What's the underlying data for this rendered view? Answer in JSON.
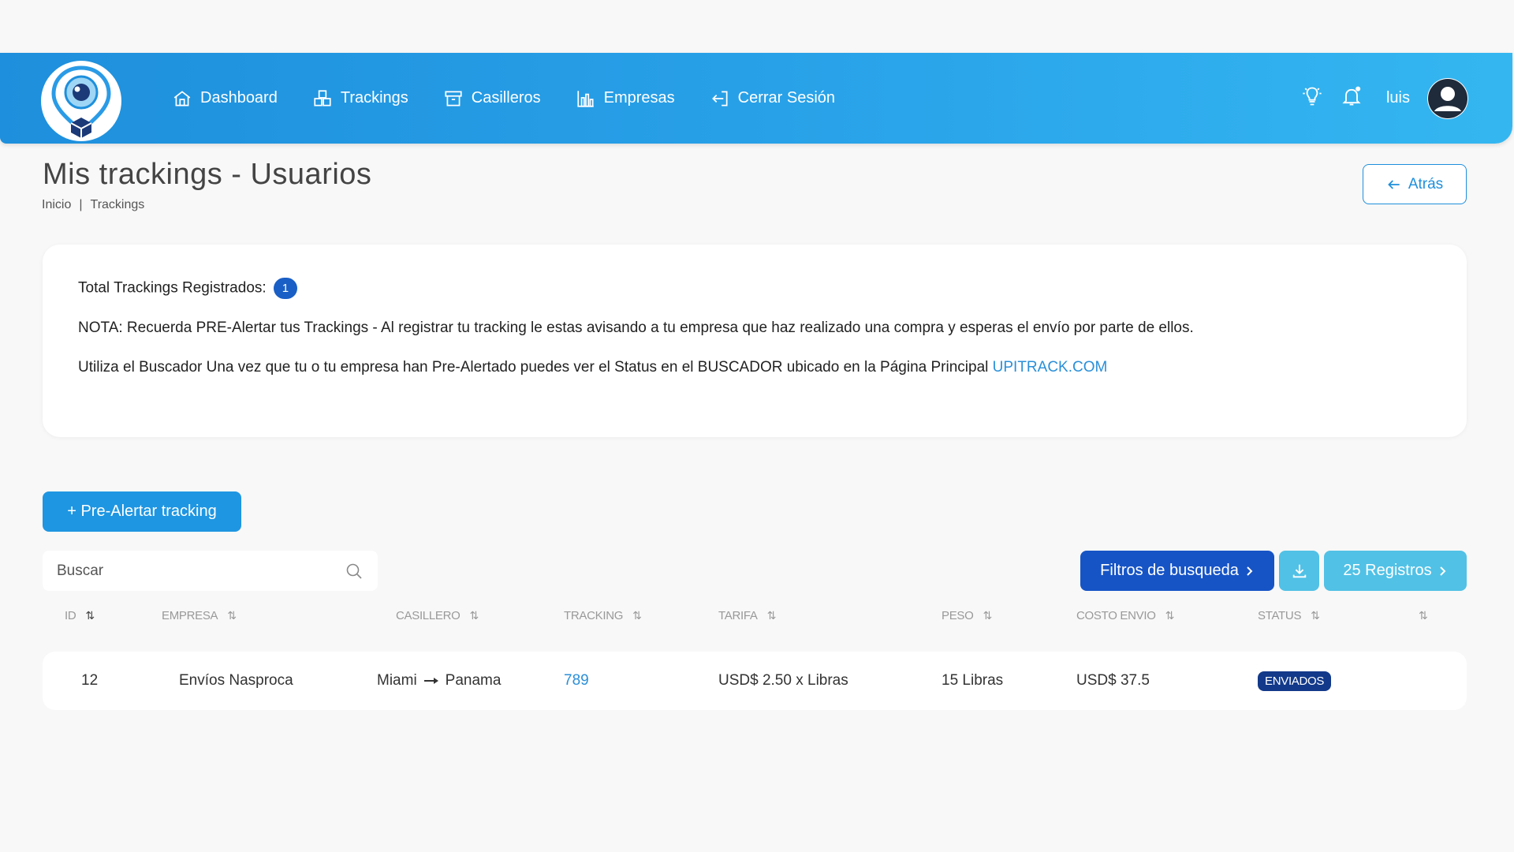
{
  "nav": {
    "items": [
      {
        "label": "Dashboard",
        "icon": "home-icon"
      },
      {
        "label": "Trackings",
        "icon": "boxes-icon"
      },
      {
        "label": "Casilleros",
        "icon": "archive-icon"
      },
      {
        "label": "Empresas",
        "icon": "bar-chart-icon"
      },
      {
        "label": "Cerrar Sesión",
        "icon": "logout-icon"
      }
    ],
    "user": "luis"
  },
  "page": {
    "title": "Mis trackings - Usuarios",
    "breadcrumb": [
      "Inicio",
      "|",
      "Trackings"
    ],
    "back_label": "Atrás"
  },
  "info": {
    "total_label": "Total Trackings Registrados:",
    "total_count": "1",
    "note": "NOTA: Recuerda PRE-Alertar tus Trackings - Al registrar tu tracking le estas avisando a tu empresa que haz realizado una compra y esperas el envío por parte de ellos.",
    "search_strong": "Utiliza el Buscador",
    "search_text": " Una vez que tu o tu empresa han Pre-Alertado puedes ver el Status en el BUSCADOR ubicado en la Página Principal ",
    "search_link": "UPITRACK.COM"
  },
  "actions": {
    "prealert_label": "+ Pre-Alertar tracking",
    "search_placeholder": "Buscar",
    "filter_label": "Filtros de busqueda",
    "records_label": "25 Registros"
  },
  "table": {
    "headers": [
      "ID",
      "EMPRESA",
      "CASILLERO",
      "TRACKING",
      "TARIFA",
      "PESO",
      "COSTO ENVIO",
      "STATUS"
    ],
    "rows": [
      {
        "id": "12",
        "empresa": "Envíos Nasproca",
        "casillero_from": "Miami",
        "casillero_to": "Panama",
        "tracking": "789",
        "tarifa": "USD$ 2.50 x Libras",
        "peso": "15 Libras",
        "costo": "USD$ 37.5",
        "status": "ENVIADOS"
      }
    ]
  },
  "colors": {
    "header_gradient_start": "#1e8fdc",
    "header_gradient_end": "#34b7f1",
    "primary": "#1e96e2",
    "filter_btn": "#1654c6",
    "accent_light": "#51c1e6",
    "status_badge": "#12398a",
    "link": "#2a8fd8"
  }
}
